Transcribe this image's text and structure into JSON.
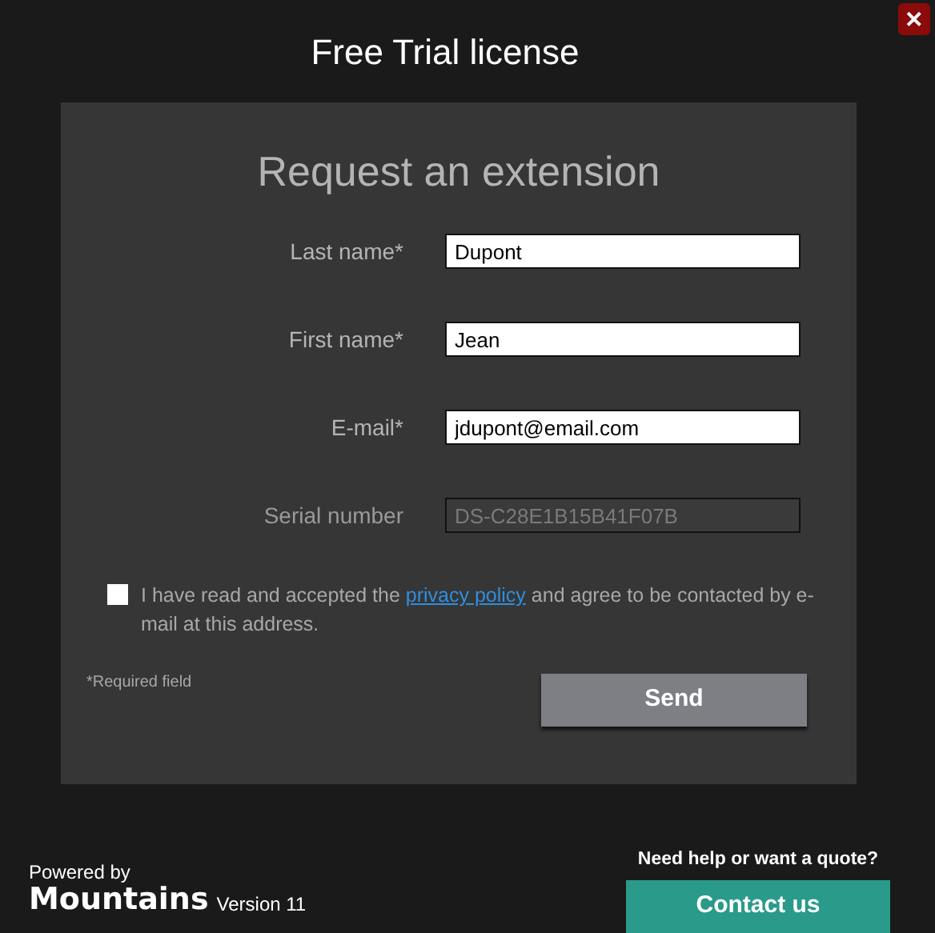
{
  "window": {
    "title": "Free Trial license",
    "close": "✕"
  },
  "form": {
    "heading": "Request an extension",
    "fields": [
      {
        "label": "Last name*",
        "value": "Dupont",
        "disabled": false
      },
      {
        "label": "First name*",
        "value": "Jean",
        "disabled": false
      },
      {
        "label": "E-mail*",
        "value": "jdupont@email.com",
        "disabled": false
      },
      {
        "label": "Serial number",
        "value": "DS-C28E1B15B41F07B",
        "disabled": true
      }
    ],
    "consent": {
      "checked": false,
      "before": "I have read and accepted the",
      "link": "privacy policy",
      "after": "and agree to be contacted by e-mail at this address."
    },
    "required_note": "*Required field",
    "send": "Send"
  },
  "footer": {
    "powered_by": "Powered by",
    "brand": "Mountains",
    "version": "Version 11",
    "help": "Need help or want a quote?",
    "contact": "Contact us"
  }
}
